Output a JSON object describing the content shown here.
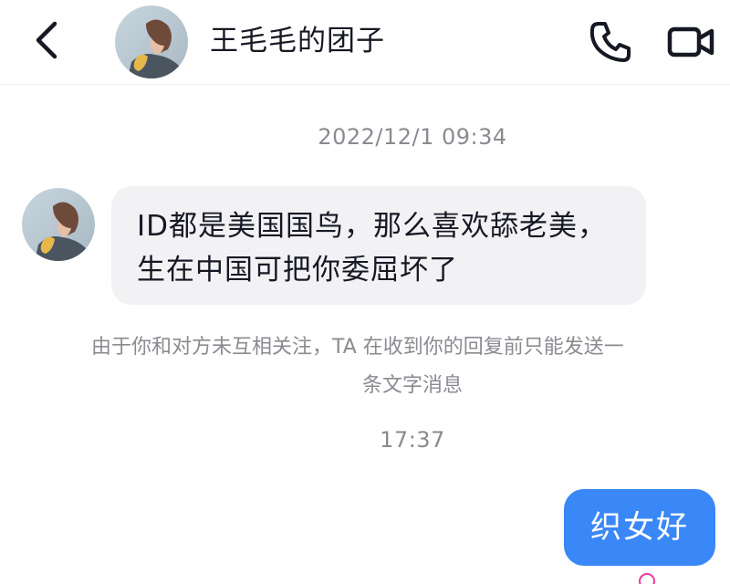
{
  "header": {
    "title": "王毛毛的团子",
    "back_icon": "chevron-left-icon",
    "call_icon": "phone-icon",
    "video_icon": "video-camera-icon"
  },
  "messages": {
    "timestamp_1": "2022/12/1 09:34",
    "incoming_text": "ID都是美国国鸟，那么喜欢舔老美，生在中国可把你委屈坏了",
    "system_notice_line1": "由于你和对方未互相关注，TA 在收到你的回复前只能发送一",
    "system_notice_line2": "条文字消息",
    "timestamp_2": "17:37",
    "outgoing_text": "织女好"
  },
  "colors": {
    "outgoing_bubble": "#3a87f7",
    "incoming_bubble": "#f2f2f4",
    "meta_text": "#8a8b91",
    "status_ring": "#f0399a"
  }
}
